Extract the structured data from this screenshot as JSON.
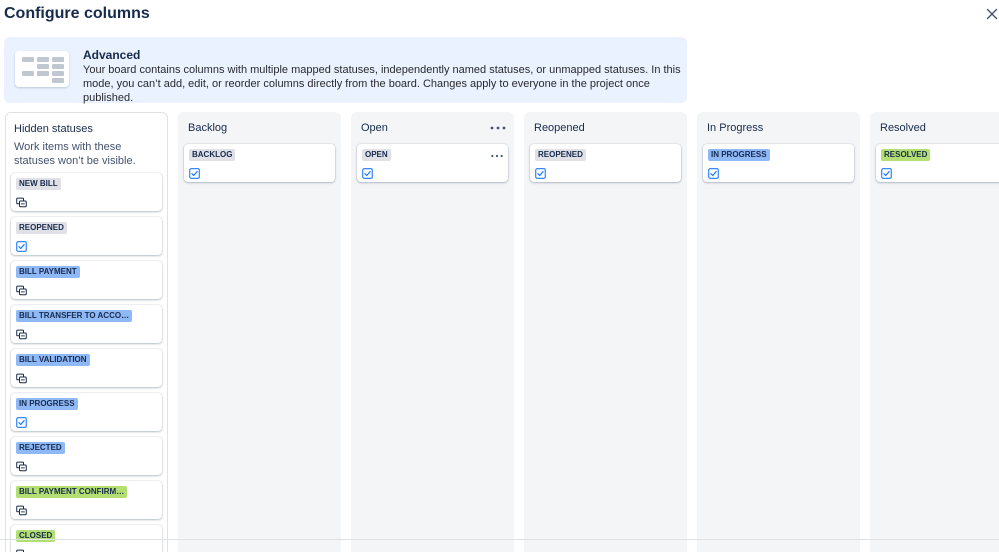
{
  "header": {
    "title": "Configure columns"
  },
  "banner": {
    "heading": "Advanced",
    "body": "Your board contains columns with multiple mapped statuses, independently named statuses, or unmapped statuses. In this mode, you can’t add, edit, or reorder columns directly from the board. Changes apply to everyone in the project once published."
  },
  "hidden_panel": {
    "title": "Hidden statuses",
    "description": "Work items with these statuses won’t be visible.",
    "statuses": [
      {
        "label": "NEW BILL",
        "color": "#dfe1e6",
        "icon": "copy-icon"
      },
      {
        "label": "REOPENED",
        "color": "#dfe1e6",
        "icon": "checkbox-icon"
      },
      {
        "label": "BILL PAYMENT",
        "color": "#8fb8f6",
        "icon": "copy-icon"
      },
      {
        "label": "BILL TRANSFER TO ACCO…",
        "color": "#8fb8f6",
        "icon": "copy-icon"
      },
      {
        "label": "BILL VALIDATION",
        "color": "#8fb8f6",
        "icon": "copy-icon"
      },
      {
        "label": "IN PROGRESS",
        "color": "#8fb8f6",
        "icon": "checkbox-icon"
      },
      {
        "label": "REJECTED",
        "color": "#8fb8f6",
        "icon": "copy-icon"
      },
      {
        "label": "BILL PAYMENT CONFIRM…",
        "color": "#b3df72",
        "icon": "copy-icon"
      },
      {
        "label": "CLOSED",
        "color": "#b3df72",
        "icon": "copy-icon"
      }
    ]
  },
  "columns": [
    {
      "title": "Backlog",
      "status": "BACKLOG",
      "color": "#dfe1e6",
      "menu": false
    },
    {
      "title": "Open",
      "status": "OPEN",
      "color": "#dfe1e6",
      "menu": true
    },
    {
      "title": "Reopened",
      "status": "REOPENED",
      "color": "#dfe1e6",
      "menu": false
    },
    {
      "title": "In Progress",
      "status": "IN PROGRESS",
      "color": "#8fb8f6",
      "menu": false
    },
    {
      "title": "Resolved",
      "status": "RESOLVED",
      "color": "#b3df72",
      "menu": false
    }
  ],
  "colors": {
    "accent": "#1d7afc",
    "banner_bg": "#e9f2fe",
    "column_bg": "#f4f5f7",
    "lozenge_gray": "#dfe1e6",
    "lozenge_blue": "#8fb8f6",
    "lozenge_green": "#b3df72"
  }
}
